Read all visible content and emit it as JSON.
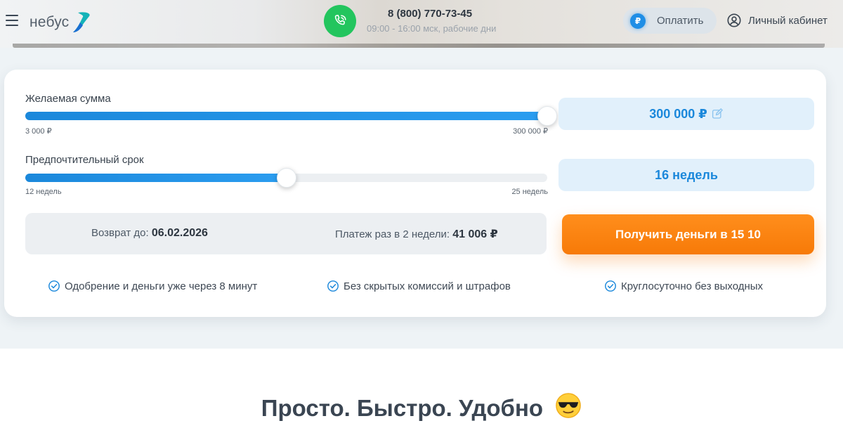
{
  "header": {
    "logo_text": "небус",
    "phone_number": "8 (800) 770-73-45",
    "work_hours": "09:00 - 16:00 мск, рабочие дни",
    "pay_coin": "₽",
    "pay_label": "Оплатить",
    "account_label": "Личный кабинет"
  },
  "calculator": {
    "amount": {
      "label": "Желаемая сумма",
      "min_label": "3 000 ₽",
      "max_label": "300 000 ₽",
      "value_display": "300 000 ₽",
      "fill_fraction": 1.0
    },
    "term": {
      "label": "Предпочтительный срок",
      "min_label": "12 недель",
      "max_label": "25 недель",
      "value_display": "16 недель",
      "fill_fraction": 0.5
    },
    "summary": {
      "return_label": "Возврат до:",
      "return_value": "06.02.2026",
      "payment_label": "Платеж раз в 2 недели:",
      "payment_value": "41 006 ₽"
    },
    "cta_label": "Получить деньги в 15 10"
  },
  "features": [
    "Одобрение и деньги уже через 8 минут",
    "Без скрытых комиссий и штрафов",
    "Круглосуточно без выходных"
  ],
  "headline": "Просто. Быстро. Удобно",
  "colors": {
    "accent_blue": "#1b88db",
    "cta_orange": "#f77a08",
    "phone_green": "#23c55e"
  }
}
